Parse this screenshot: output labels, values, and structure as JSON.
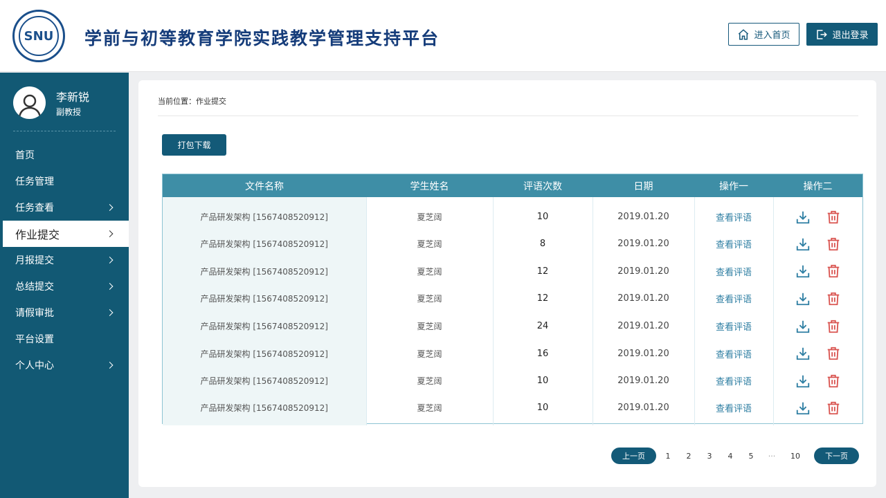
{
  "header": {
    "logo_text": "SNU",
    "title": "学前与初等教育学院实践教学管理支持平台",
    "home_label": "进入首页",
    "logout_label": "退出登录",
    "home_icon": "home-icon",
    "logout_icon": "logout-icon"
  },
  "user": {
    "name": "李新锐",
    "role": "副教授"
  },
  "sidebar": {
    "items": [
      {
        "label": "首页",
        "chevron": false
      },
      {
        "label": "任务管理",
        "chevron": false
      },
      {
        "label": "任务查看",
        "chevron": true
      },
      {
        "label": "作业提交",
        "chevron": true,
        "active": true
      },
      {
        "label": "月报提交",
        "chevron": true
      },
      {
        "label": "总结提交",
        "chevron": true
      },
      {
        "label": "请假审批",
        "chevron": true
      },
      {
        "label": "平台设置",
        "chevron": false
      },
      {
        "label": "个人中心",
        "chevron": true
      }
    ]
  },
  "main": {
    "breadcrumb": "当前位置：作业提交",
    "pack_download_label": "打包下载",
    "table": {
      "headers": [
        "文件名称",
        "学生姓名",
        "评语次数",
        "日期",
        "操作一",
        "操作二"
      ],
      "rows": [
        {
          "file": "产品研发架构 [1567408520912]",
          "student": "夏芝阔",
          "count": "10",
          "date": "2019.01.20",
          "action": "查看评语"
        },
        {
          "file": "产品研发架构 [1567408520912]",
          "student": "夏芝阔",
          "count": "8",
          "date": "2019.01.20",
          "action": "查看评语"
        },
        {
          "file": "产品研发架构 [1567408520912]",
          "student": "夏芝阔",
          "count": "12",
          "date": "2019.01.20",
          "action": "查看评语"
        },
        {
          "file": "产品研发架构 [1567408520912]",
          "student": "夏芝阔",
          "count": "12",
          "date": "2019.01.20",
          "action": "查看评语"
        },
        {
          "file": "产品研发架构 [1567408520912]",
          "student": "夏芝阔",
          "count": "24",
          "date": "2019.01.20",
          "action": "查看评语"
        },
        {
          "file": "产品研发架构 [1567408520912]",
          "student": "夏芝阔",
          "count": "16",
          "date": "2019.01.20",
          "action": "查看评语"
        },
        {
          "file": "产品研发架构 [1567408520912]",
          "student": "夏芝阔",
          "count": "10",
          "date": "2019.01.20",
          "action": "查看评语"
        },
        {
          "file": "产品研发架构 [1567408520912]",
          "student": "夏芝阔",
          "count": "10",
          "date": "2019.01.20",
          "action": "查看评语"
        }
      ],
      "row_icons": [
        "download-icon",
        "trash-icon"
      ]
    },
    "pagination": {
      "prev_label": "上一页",
      "next_label": "下一页",
      "pages": [
        "1",
        "2",
        "3",
        "4",
        "5",
        "···",
        "10"
      ]
    }
  },
  "colors": {
    "primary": "#135a78",
    "header_row": "#3e8ea6",
    "title": "#153c7a",
    "delete": "#d9534f",
    "link": "#2d7ea2"
  }
}
